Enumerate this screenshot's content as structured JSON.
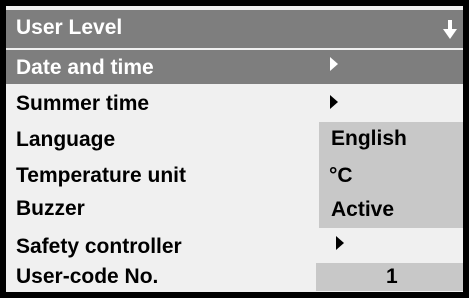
{
  "header": {
    "title": "User Level",
    "scroll_icon": "down-arrow-icon"
  },
  "menu": {
    "date_time": {
      "label": "Date and time",
      "icon": "right-triangle-icon"
    },
    "summer_time": {
      "label": "Summer time",
      "icon": "right-triangle-icon"
    },
    "language": {
      "label": "Language",
      "value": "English"
    },
    "temperature_unit": {
      "label": "Temperature unit",
      "value": "°C"
    },
    "buzzer": {
      "label": "Buzzer",
      "value": "Active"
    },
    "safety_controller": {
      "label": "Safety controller",
      "icon": "right-triangle-icon"
    },
    "user_code": {
      "label": "User-code No.",
      "value": "1"
    }
  },
  "colors": {
    "frame": "#000000",
    "background": "#f0f0f0",
    "highlight": "#7e7e7e",
    "value_box": "#c8c8c8",
    "text": "#000000",
    "highlight_text": "#ffffff"
  }
}
